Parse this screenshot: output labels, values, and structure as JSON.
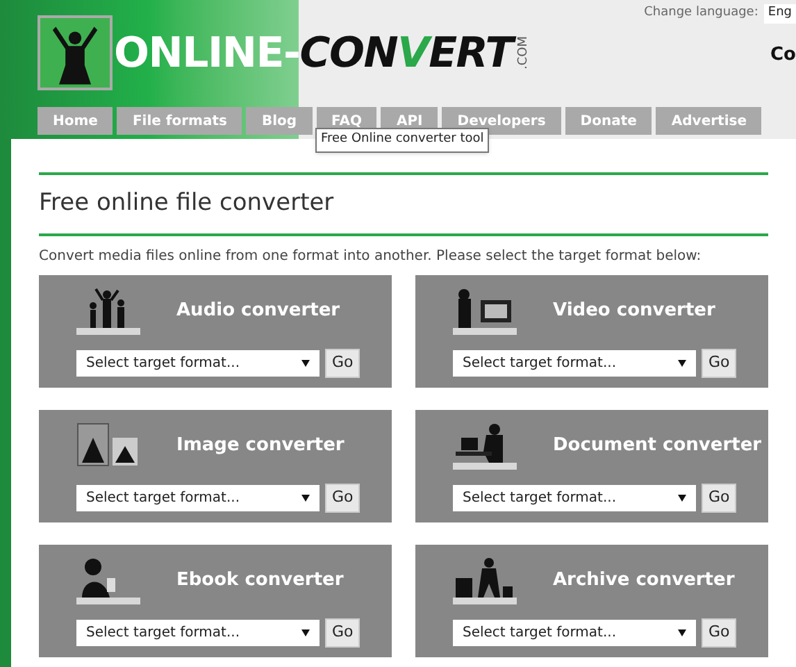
{
  "header": {
    "logo": {
      "first": "ONLINE-",
      "second_a": "CON",
      "second_v": "V",
      "second_b": "ERT",
      "suffix": ".COM"
    },
    "language_label": "Change language:",
    "language_value": "Eng",
    "side_text": "Co"
  },
  "nav": [
    {
      "label": "Home"
    },
    {
      "label": "File formats"
    },
    {
      "label": "Blog"
    },
    {
      "label": "FAQ"
    },
    {
      "label": "API"
    },
    {
      "label": "Developers"
    },
    {
      "label": "Donate"
    },
    {
      "label": "Advertise"
    }
  ],
  "tooltip": "Free Online converter tool",
  "title": "Free online file converter",
  "intro": "Convert media files online from one format into another. Please select the target format below:",
  "converters": [
    {
      "kind": "audio",
      "title": "Audio converter",
      "placeholder": "Select target format...",
      "button": "Go"
    },
    {
      "kind": "video",
      "title": "Video converter",
      "placeholder": "Select target format...",
      "button": "Go"
    },
    {
      "kind": "image",
      "title": "Image converter",
      "placeholder": "Select target format...",
      "button": "Go"
    },
    {
      "kind": "document",
      "title": "Document converter",
      "placeholder": "Select target format...",
      "button": "Go"
    },
    {
      "kind": "ebook",
      "title": "Ebook converter",
      "placeholder": "Select target format...",
      "button": "Go"
    },
    {
      "kind": "archive",
      "title": "Archive converter",
      "placeholder": "Select target format...",
      "button": "Go"
    }
  ]
}
